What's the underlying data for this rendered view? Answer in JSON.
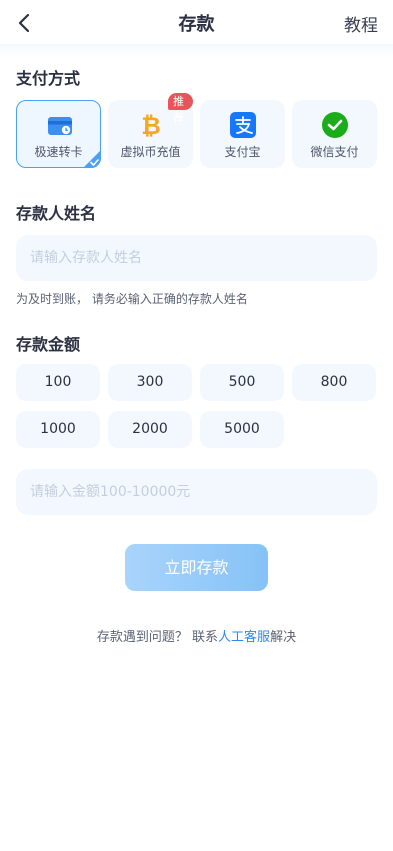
{
  "header": {
    "title": "存款",
    "tutorial_label": "教程"
  },
  "payment": {
    "section_title": "支付方式",
    "methods": [
      {
        "label": "极速转卡",
        "icon": "bank-card-icon",
        "selected": true
      },
      {
        "label": "虚拟币充值",
        "icon": "bitcoin-icon",
        "badge": "推荐"
      },
      {
        "label": "支付宝",
        "icon": "alipay-icon"
      },
      {
        "label": "微信支付",
        "icon": "wechat-pay-icon"
      }
    ]
  },
  "depositor": {
    "section_title": "存款人姓名",
    "placeholder": "请输入存款人姓名",
    "hint": "为及时到账， 请务必输入正确的存款人姓名"
  },
  "amount": {
    "section_title": "存款金额",
    "presets": [
      "100",
      "300",
      "500",
      "800",
      "1000",
      "2000",
      "5000"
    ],
    "placeholder": "请输入金额100-10000元"
  },
  "submit_label": "立即存款",
  "help": {
    "prefix": "存款遇到问题？ 联系",
    "link": "人工客服",
    "suffix": "解决"
  },
  "colors": {
    "accent": "#2a8af0",
    "badge": "#e5565a",
    "selected_border": "#4ca0f5"
  }
}
